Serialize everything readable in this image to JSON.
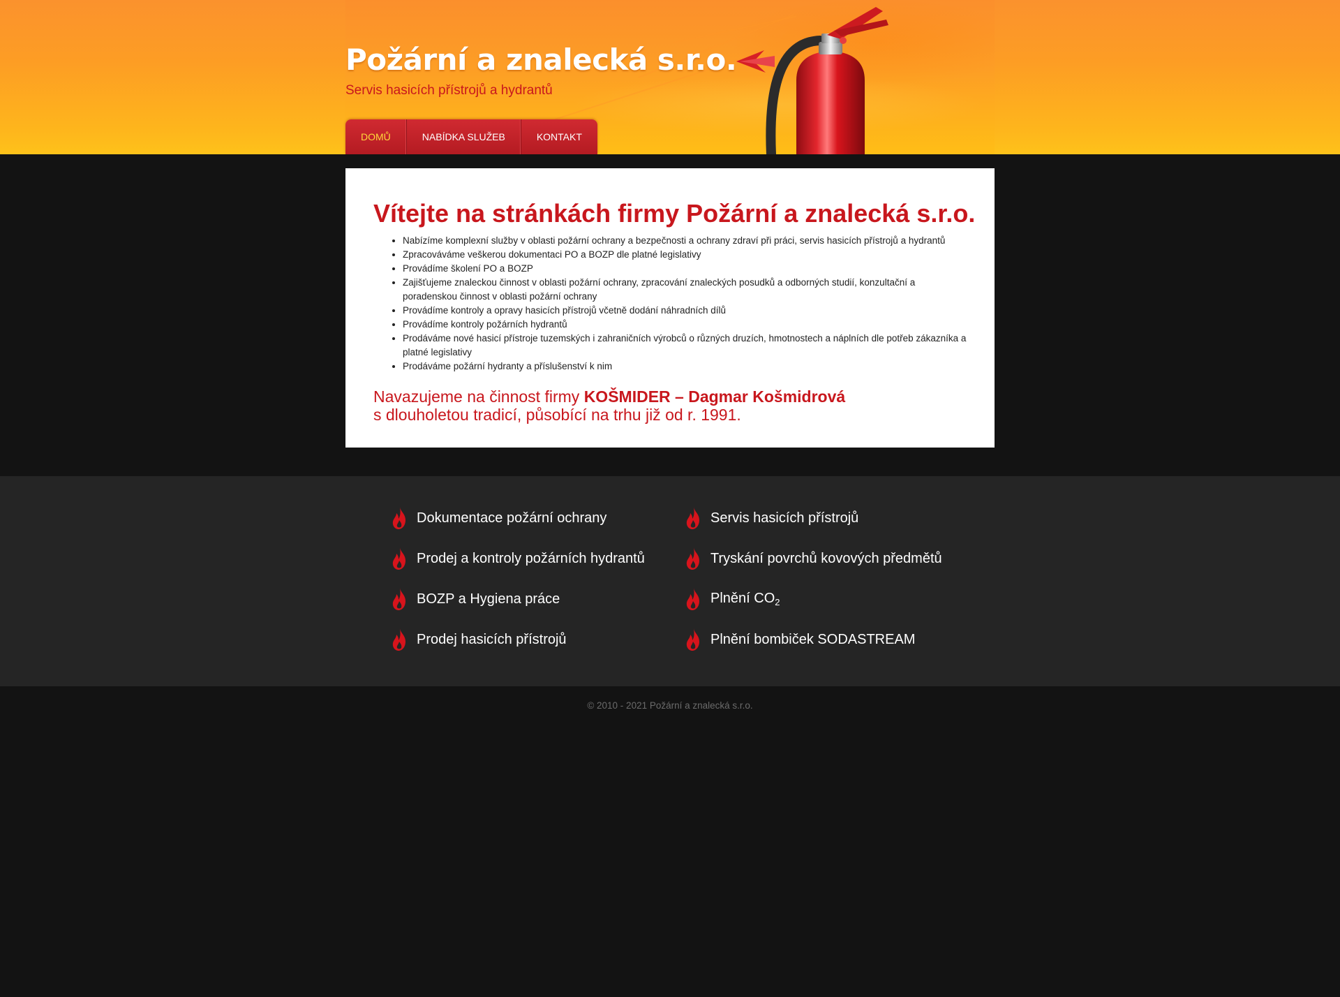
{
  "header": {
    "title": "Požární a znalecká s.r.o.",
    "subtitle": "Servis hasicích přístrojů a hydrantů",
    "nav": [
      {
        "label": "DOMŮ",
        "active": true
      },
      {
        "label": "NABÍDKA SLUŽEB",
        "active": false
      },
      {
        "label": "KONTAKT",
        "active": false
      }
    ]
  },
  "main": {
    "heading": "Vítejte na stránkách firmy Požární a znalecká s.r.o.",
    "services": [
      "Nabízíme komplexní služby v oblasti požární ochrany a bezpečnosti a ochrany zdraví při práci, servis hasicích přístrojů a hydrantů",
      "Zpracováváme veškerou dokumentaci PO a BOZP dle platné legislativy",
      "Provádíme školení PO a BOZP",
      "Zajišťujeme znaleckou činnost v oblasti požární ochrany, zpracování znaleckých posudků a odborných studií, konzultační a poradenskou činnost v oblasti požární ochrany",
      "Provádíme kontroly a opravy hasicích přístrojů včetně dodání náhradních dílů",
      "Provádíme kontroly požárních hydrantů",
      "Prodáváme nové hasicí přístroje tuzemských i zahraničních výrobců o různých druzích, hmotnostech a náplních dle potřeb zákazníka a platné legislativy",
      "Prodáváme požární hydranty a příslušenství k nim"
    ],
    "continuation": {
      "prefix": "Navazujeme na činnost firmy ",
      "company": "KOŠMIDER – Dagmar Košmidrová",
      "line2": "s dlouholetou tradicí, působící na trhu již od r. 1991."
    }
  },
  "links": {
    "left": [
      {
        "label": "Dokumentace požární ochrany"
      },
      {
        "label": "Prodej a kontroly požárních hydrantů"
      },
      {
        "label": "BOZP a Hygiena práce"
      },
      {
        "label": "Prodej hasicích přístrojů"
      }
    ],
    "right": [
      {
        "label": "Servis hasicích přístrojů"
      },
      {
        "label": "Tryskání povrchů kovových předmětů"
      },
      {
        "label": "Plnění CO",
        "sub": "2"
      },
      {
        "label": "Plnění bombiček SODASTREAM"
      }
    ],
    "icon": "flame-icon"
  },
  "footer": {
    "copyright": "© 2010 - 2021 Požární a znalecká s.r.o."
  },
  "colors": {
    "accent_red": "#c8171d",
    "nav_active": "#ffd83a",
    "header_orange": "#fd9d24",
    "header_yellow": "#fec21a",
    "page_bg": "#131313",
    "links_band_bg": "#252525"
  }
}
